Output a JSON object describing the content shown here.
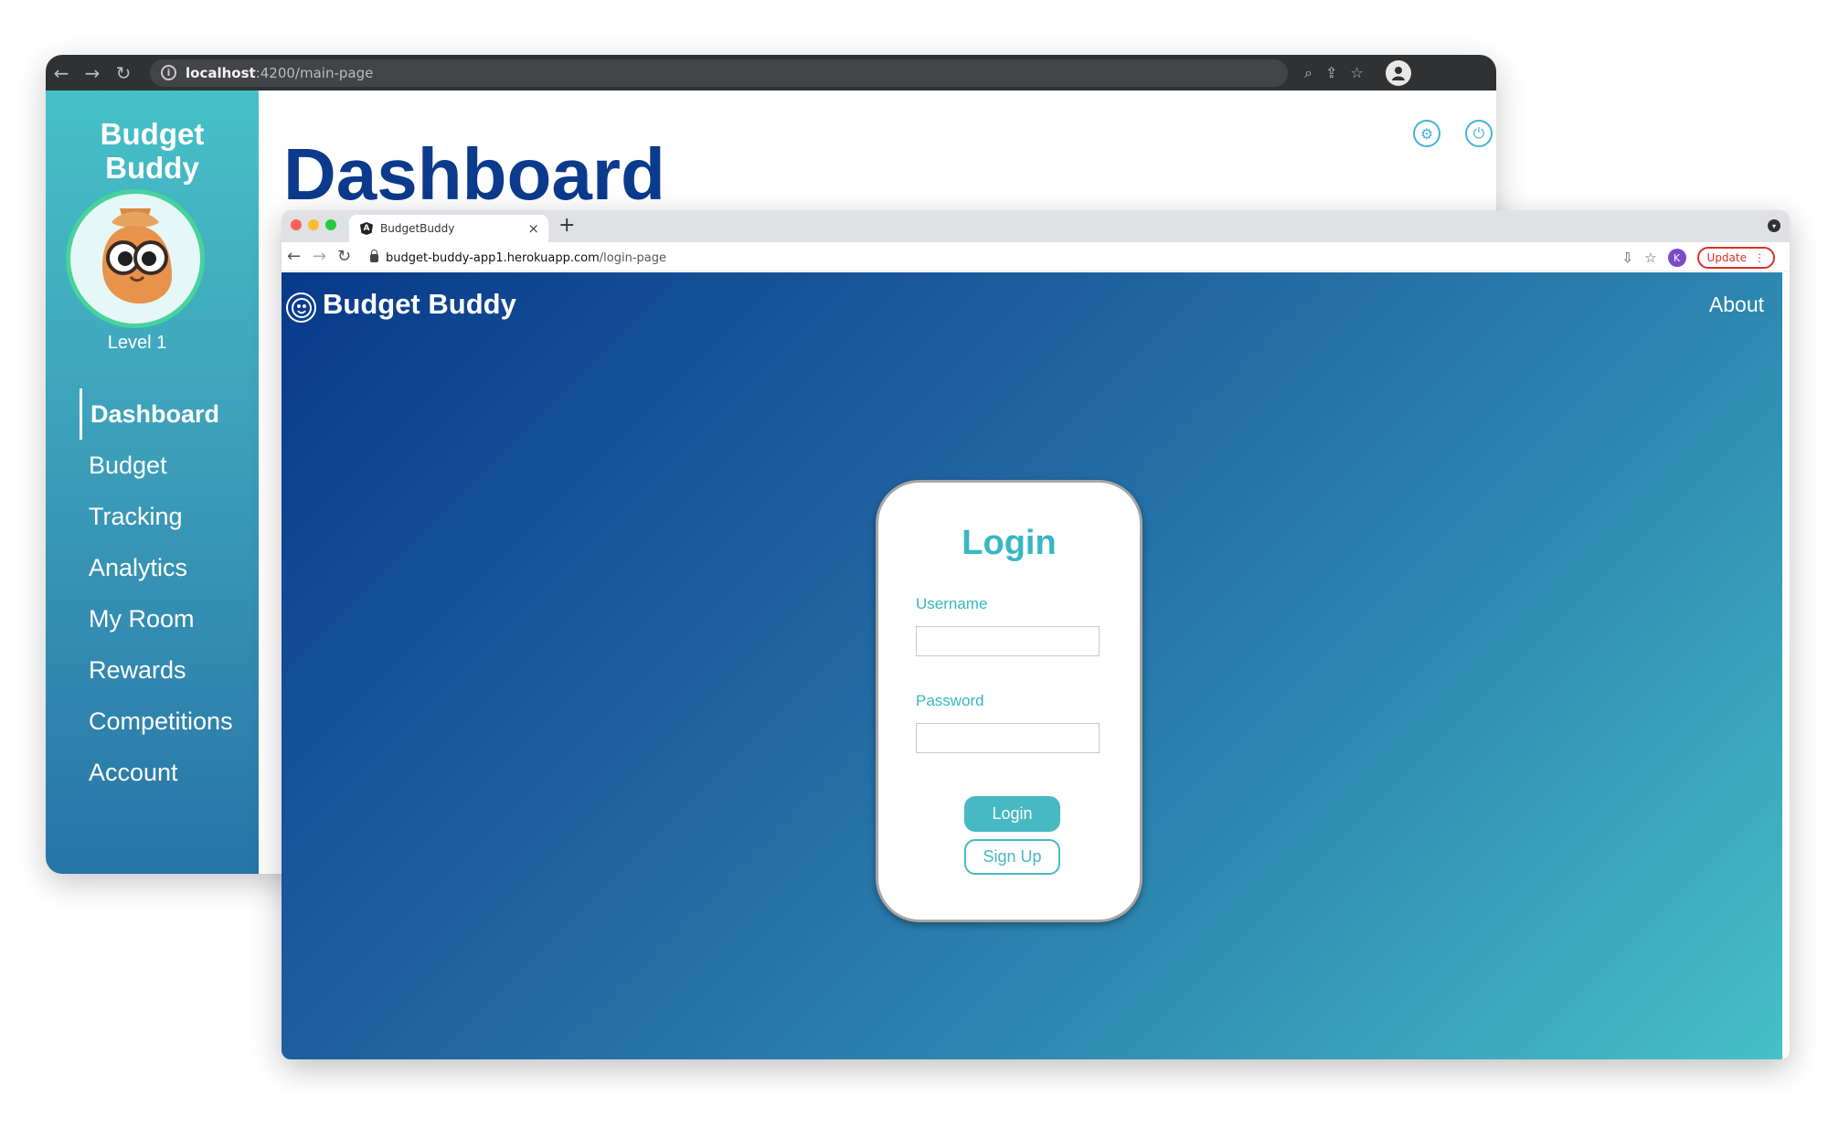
{
  "back_window": {
    "url_host": "localhost",
    "url_path": ":4200/main-page",
    "brand_line1": "Budget",
    "brand_line2": "Buddy",
    "level": "Level 1",
    "page_title": "Dashboard",
    "nav": [
      {
        "label": "Dashboard",
        "active": true
      },
      {
        "label": "Budget"
      },
      {
        "label": "Tracking"
      },
      {
        "label": "Analytics"
      },
      {
        "label": "My Room"
      },
      {
        "label": "Rewards"
      },
      {
        "label": "Competitions"
      },
      {
        "label": "Account"
      }
    ]
  },
  "front_window": {
    "tab_title": "BudgetBuddy",
    "url_host": "budget-buddy-app1.herokuapp.com",
    "url_path": "/login-page",
    "profile_initial": "K",
    "update_label": "Update",
    "brand": "Budget Buddy",
    "about_label": "About",
    "login": {
      "title": "Login",
      "username_label": "Username",
      "password_label": "Password",
      "login_button": "Login",
      "signup_button": "Sign Up"
    }
  },
  "colors": {
    "sidebar_gradient_top": "#46c1c7",
    "sidebar_gradient_bottom": "#2774a6",
    "accent": "#37b7c3",
    "page_gradient_start": "#083a8a",
    "page_gradient_end": "#46c0c8",
    "dashboard_title": "#0c3a8c"
  }
}
